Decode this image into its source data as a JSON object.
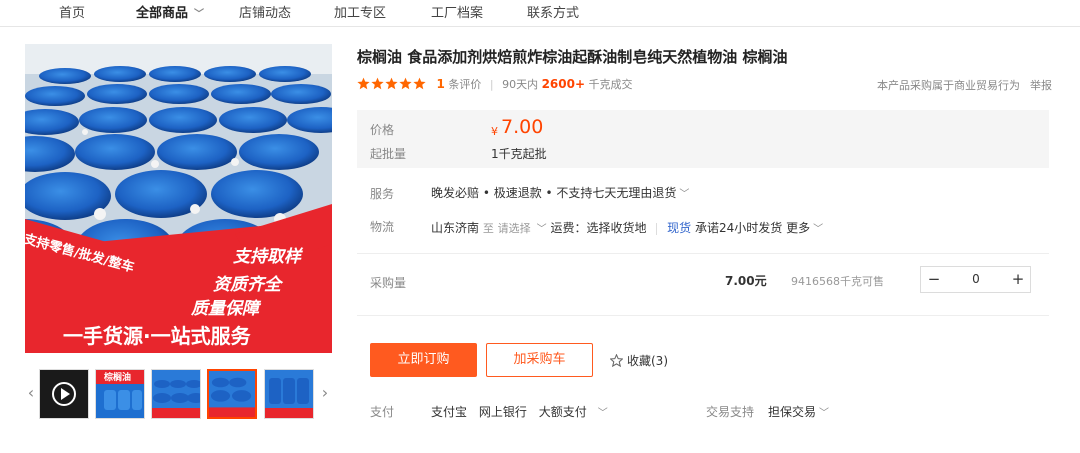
{
  "nav": {
    "items": [
      {
        "label": "首页"
      },
      {
        "label": "全部商品"
      },
      {
        "label": "店铺动态"
      },
      {
        "label": "加工专区"
      },
      {
        "label": "工厂档案"
      },
      {
        "label": "联系方式"
      }
    ]
  },
  "gallery": {
    "banner_left": "支持零售/批发/整车",
    "banner_lines": [
      "支持取样",
      "资质齐全",
      "质量保障"
    ],
    "banner_bottom": "一手货源·一站式服务",
    "thumb_label": "棕榈油"
  },
  "product": {
    "title": "棕榈油 食品添加剂烘焙煎炸棕油起酥油制皂纯天然植物油 棕榈油",
    "rating_count": "1",
    "rating_suffix": "条评价",
    "days_label": "90天内",
    "sold": "2600+",
    "sold_suffix": "千克成交",
    "trade_note": "本产品采购属于商业贸易行为",
    "report": "举报"
  },
  "price": {
    "label": "价格",
    "currency": "¥",
    "value": "7.00",
    "moq_label": "起批量",
    "moq": "1千克起批"
  },
  "service": {
    "label": "服务",
    "text": "晚发必赔 • 极速退款 • 不支持七天无理由退货"
  },
  "logistics": {
    "label": "物流",
    "origin": "山东济南",
    "to": "至",
    "choose": "请选择",
    "fee": "运费：选择收货地",
    "stock": "现货",
    "promise": "承诺24小时发货",
    "more": "更多"
  },
  "purchase": {
    "label": "采购量",
    "unit_price": "7.00元",
    "stock": "9416568千克可售",
    "minus": "−",
    "plus": "+",
    "qty": "0"
  },
  "actions": {
    "buy": "立即订购",
    "cart": "加采购车",
    "fav": "收藏(3)"
  },
  "payment": {
    "label": "支付",
    "methods": [
      "支付宝",
      "网上银行",
      "大额支付"
    ],
    "support_label": "交易支持",
    "support_value": "担保交易"
  },
  "colors": {
    "accent": "#ff5a1f",
    "price": "#ff4400",
    "banner_red": "#e8262d",
    "barrel_blue": "#1e6fd0"
  }
}
